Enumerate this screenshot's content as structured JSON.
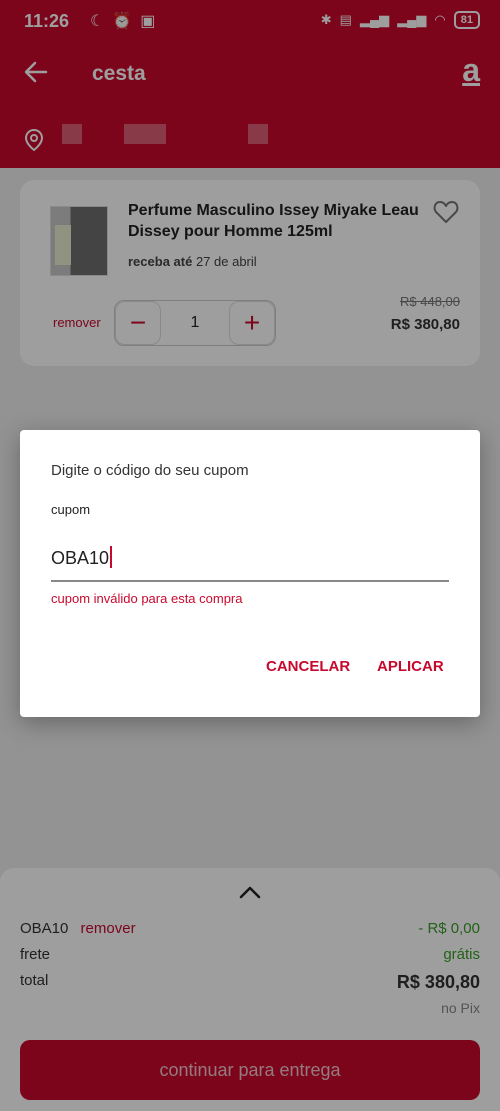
{
  "status_bar": {
    "time": "11:26",
    "battery": "81"
  },
  "header": {
    "title": "cesta",
    "brand_glyph": "a"
  },
  "product": {
    "name": "Perfume Masculino Issey Miyake Leau Dissey pour Homme 125ml",
    "delivery_prefix": "receba até",
    "delivery_date": "27 de abril",
    "remove_label": "remover",
    "quantity": "1",
    "old_price": "R$ 448,00",
    "price": "R$ 380,80"
  },
  "dialog": {
    "title": "Digite o código do seu cupom",
    "label": "cupom",
    "value": "OBA10",
    "error": "cupom inválido para esta compra",
    "cancel_label": "CANCELAR",
    "apply_label": "APLICAR"
  },
  "summary": {
    "coupon_code": "OBA10",
    "coupon_remove": "remover",
    "coupon_value": "- R$ 0,00",
    "shipping_label": "frete",
    "shipping_value": "grátis",
    "total_label": "total",
    "total_value": "R$ 380,80",
    "payment_note": "no Pix",
    "continue_label": "continuar para entrega"
  },
  "colors": {
    "brand": "#c8092e",
    "success": "#3a9b2a"
  }
}
